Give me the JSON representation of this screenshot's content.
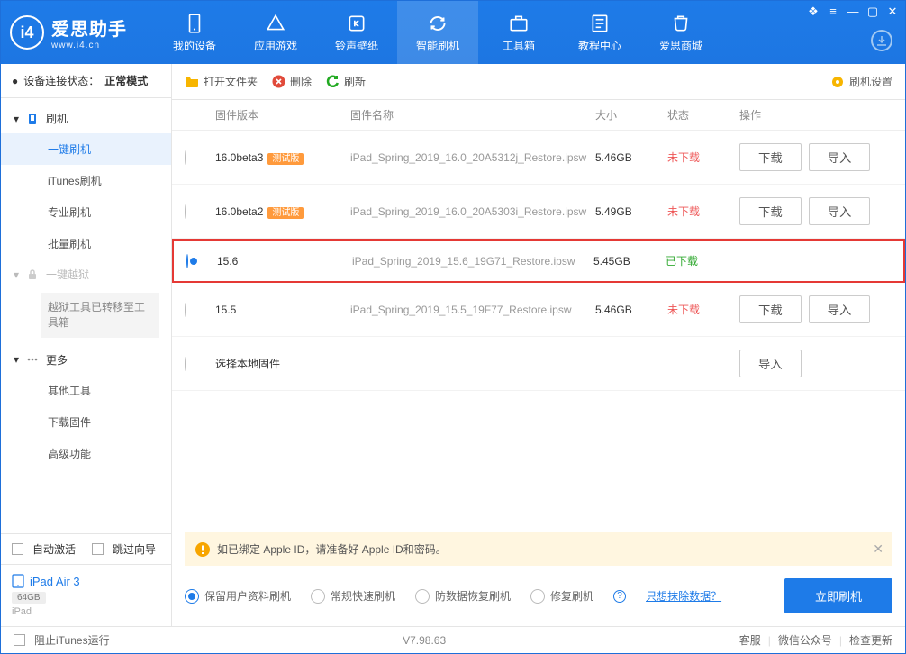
{
  "header": {
    "brand": "爱思助手",
    "brand_sub": "www.i4.cn",
    "tabs": [
      "我的设备",
      "应用游戏",
      "铃声壁纸",
      "智能刷机",
      "工具箱",
      "教程中心",
      "爱思商城"
    ],
    "active_tab": 3
  },
  "sidebar": {
    "conn_label": "设备连接状态：",
    "conn_value": "正常模式",
    "group_flash": "刷机",
    "items_flash": [
      "一键刷机",
      "iTunes刷机",
      "专业刷机",
      "批量刷机"
    ],
    "active_flash": 0,
    "group_jb": "一键越狱",
    "jb_note": "越狱工具已转移至工具箱",
    "group_more": "更多",
    "items_more": [
      "其他工具",
      "下载固件",
      "高级功能"
    ],
    "auto_activate": "自动激活",
    "skip_guide": "跳过向导",
    "device_name": "iPad Air 3",
    "device_storage": "64GB",
    "device_type": "iPad"
  },
  "toolbar": {
    "open": "打开文件夹",
    "delete": "删除",
    "refresh": "刷新",
    "settings": "刷机设置"
  },
  "table": {
    "cols": {
      "ver": "固件版本",
      "name": "固件名称",
      "size": "大小",
      "status": "状态",
      "ops": "操作"
    },
    "beta_label": "测试版",
    "btn_dl": "下载",
    "btn_imp": "导入",
    "status_nd": "未下载",
    "status_dl": "已下载",
    "local_fw": "选择本地固件",
    "rows": [
      {
        "ver": "16.0beta3",
        "beta": true,
        "name": "iPad_Spring_2019_16.0_20A5312j_Restore.ipsw",
        "size": "5.46GB",
        "status": "nd",
        "selected": false,
        "ops": [
          "dl",
          "imp"
        ]
      },
      {
        "ver": "16.0beta2",
        "beta": true,
        "name": "iPad_Spring_2019_16.0_20A5303i_Restore.ipsw",
        "size": "5.49GB",
        "status": "nd",
        "selected": false,
        "ops": [
          "dl",
          "imp"
        ]
      },
      {
        "ver": "15.6",
        "beta": false,
        "name": "iPad_Spring_2019_15.6_19G71_Restore.ipsw",
        "size": "5.45GB",
        "status": "dl",
        "selected": true,
        "ops": []
      },
      {
        "ver": "15.5",
        "beta": false,
        "name": "iPad_Spring_2019_15.5_19F77_Restore.ipsw",
        "size": "5.46GB",
        "status": "nd",
        "selected": false,
        "ops": [
          "dl",
          "imp"
        ]
      }
    ]
  },
  "warn": {
    "text": "如已绑定 Apple ID，请准备好 Apple ID和密码。"
  },
  "flash": {
    "opts": [
      "保留用户资料刷机",
      "常规快速刷机",
      "防数据恢复刷机",
      "修复刷机"
    ],
    "active_opt": 0,
    "erase_link": "只想抹除数据？",
    "btn": "立即刷机"
  },
  "footer": {
    "block_itunes": "阻止iTunes运行",
    "version": "V7.98.63",
    "links": [
      "客服",
      "微信公众号",
      "检查更新"
    ]
  }
}
